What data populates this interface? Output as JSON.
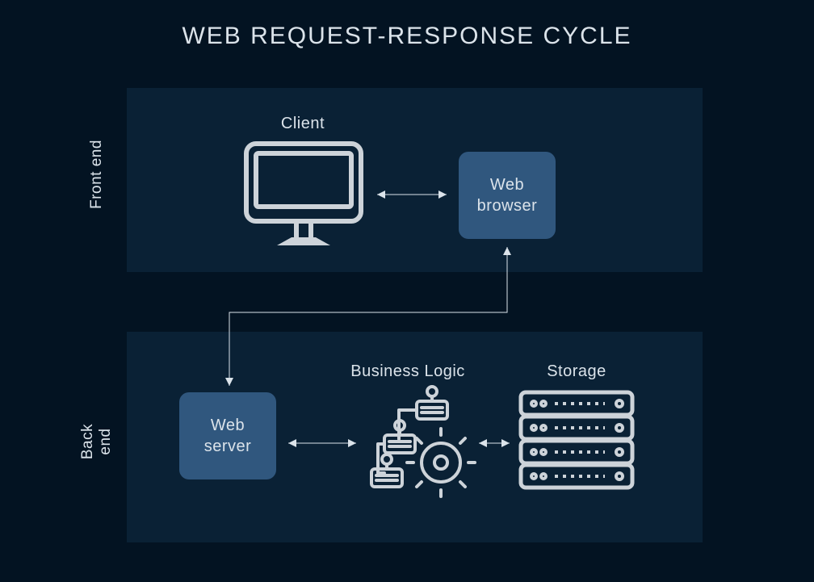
{
  "title": "WEB REQUEST-RESPONSE CYCLE",
  "sections": {
    "front": "Front end",
    "back": "Back end"
  },
  "nodes": {
    "client": "Client",
    "web_browser_l1": "Web",
    "web_browser_l2": "browser",
    "web_server_l1": "Web",
    "web_server_l2": "server",
    "business_logic": "Business Logic",
    "storage": "Storage"
  }
}
